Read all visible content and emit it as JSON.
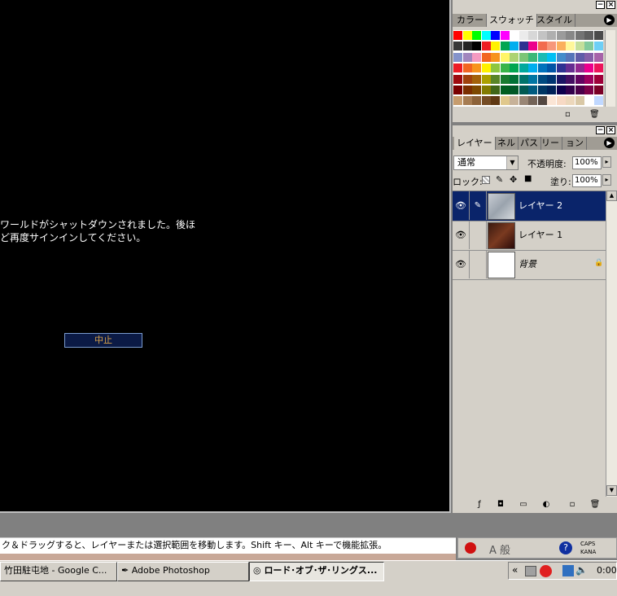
{
  "game": {
    "message": "ワールドがシャットダウンされました。後ほ\nど再度サインインしてください。",
    "abort_label": "中止"
  },
  "swatches_panel": {
    "tabs": [
      "カラー",
      "スウォッチ",
      "スタイル"
    ],
    "active_tab": "スウォッチ",
    "colors": [
      [
        "#ff0000",
        "#ffff00",
        "#00ff00",
        "#00ffff",
        "#0000ff",
        "#ff00ff",
        "#ffffff",
        "#ebebeb",
        "#d7d7d7",
        "#c3c3c3",
        "#afafaf",
        "#9b9b9b",
        "#878787",
        "#737373",
        "#5f5f5f",
        "#4b4b4b"
      ],
      [
        "#373737",
        "#232323",
        "#000000",
        "#ee1d24",
        "#fff200",
        "#00a651",
        "#00aeef",
        "#2e3192",
        "#ec008c",
        "#f26c4f",
        "#f7977a",
        "#fbaf5d",
        "#fff79a",
        "#c4df9b",
        "#82ca9c",
        "#6dcff6"
      ],
      [
        "#8493ca",
        "#a186be",
        "#f49ac1",
        "#f26522",
        "#f7941d",
        "#fff568",
        "#acd372",
        "#7cc576",
        "#3bb878",
        "#1abbb4",
        "#00bff3",
        "#438ccb",
        "#5574b9",
        "#605ca8",
        "#855fa8",
        "#a763a9"
      ],
      [
        "#ed1c24",
        "#f26522",
        "#f7941d",
        "#fff200",
        "#8dc63f",
        "#39b54a",
        "#00a651",
        "#00a99d",
        "#00aeef",
        "#0072bc",
        "#0054a6",
        "#2e3192",
        "#662d91",
        "#92278f",
        "#ec008c",
        "#ed145b"
      ],
      [
        "#9e0b0f",
        "#a0410d",
        "#a3620a",
        "#aba000",
        "#598527",
        "#197b30",
        "#007236",
        "#00746b",
        "#0076a3",
        "#004a80",
        "#003471",
        "#1b1464",
        "#440e62",
        "#630460",
        "#9e005d",
        "#9e0039"
      ],
      [
        "#790000",
        "#7b2e00",
        "#7d4900",
        "#827b00",
        "#406618",
        "#005e20",
        "#005826",
        "#005952",
        "#005b7f",
        "#003663",
        "#002157",
        "#0d004c",
        "#32004b",
        "#4b0049",
        "#7b0046",
        "#7a0026"
      ],
      [
        "#c69c6d",
        "#a67c52",
        "#8c6239",
        "#754c24",
        "#603913",
        "#e0c88c",
        "#c7b299",
        "#998675",
        "#736357",
        "#534741",
        "#fbe5d5",
        "#f7d9c4",
        "#ecd7bb",
        "#d9c8a6",
        "#ffffff",
        "#c0d8ff"
      ]
    ]
  },
  "layers_panel": {
    "tabs": [
      "レイヤー",
      "ネル",
      "パス",
      "リー",
      "ョン"
    ],
    "active_tab": "レイヤー",
    "blend_mode": "通常",
    "opacity_label": "不透明度:",
    "opacity_value": "100%",
    "lock_label": "ロック:",
    "fill_label": "塗り:",
    "fill_value": "100%",
    "layers": [
      {
        "name": "レイヤー 2",
        "selected": true
      },
      {
        "name": "レイヤー 1",
        "selected": false
      },
      {
        "name": "背景",
        "selected": false
      }
    ]
  },
  "statusbar": {
    "text": "ク＆ドラッグすると、レイヤーまたは選択範囲を移動します。Shift キー、Alt キーで機能拡張。"
  },
  "ime": {
    "mode": "A 般",
    "caps": "CAPS",
    "kana": "KANA"
  },
  "taskbar": {
    "items": [
      {
        "label": "竹田駐屯地 - Google C...",
        "pressed": false
      },
      {
        "label": "Adobe Photoshop",
        "pressed": false
      },
      {
        "label": "ロード･オブ･ザ･リングス...",
        "pressed": true
      }
    ],
    "tray_chevron": "«",
    "clock": "0:00"
  }
}
